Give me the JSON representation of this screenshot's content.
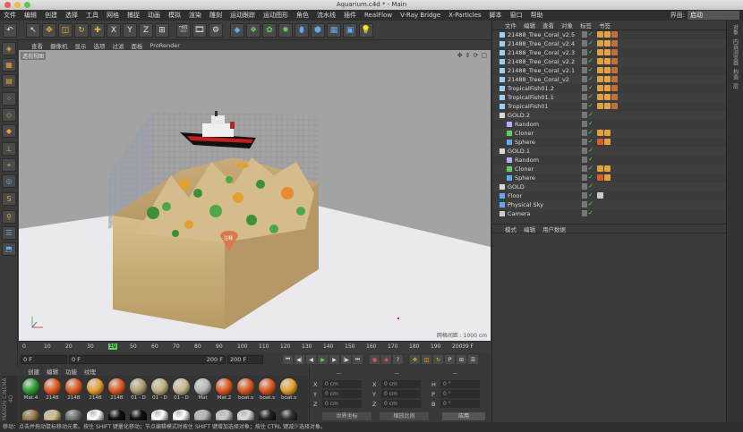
{
  "window": {
    "title": "Aquarium.c4d * - Main"
  },
  "menubar": {
    "items": [
      "文件",
      "编辑",
      "创建",
      "选择",
      "工具",
      "网格",
      "捕捉",
      "动画",
      "模拟",
      "渲染",
      "雕刻",
      "运动跟踪",
      "运动图形",
      "角色",
      "流水线",
      "插件",
      "RealFlow",
      "V-Ray Bridge",
      "X-Particles",
      "脚本",
      "窗口",
      "帮助"
    ],
    "layout_label": "界面:",
    "layout_value": "启动"
  },
  "toolbar": {
    "axis_x": "X",
    "axis_y": "Y",
    "axis_z": "Z"
  },
  "viewport": {
    "menu": [
      "查看",
      "摄像机",
      "显示",
      "选项",
      "过滤",
      "面板",
      "ProRender"
    ],
    "label": "透视视图",
    "grid_spacing": "网格间距 : 1000 cm",
    "note": "注释"
  },
  "timeline": {
    "ticks": [
      "0",
      "10",
      "20",
      "30",
      "39",
      "50",
      "60",
      "70",
      "80",
      "90",
      "100",
      "110",
      "120",
      "130",
      "140",
      "150",
      "160",
      "170",
      "180",
      "190",
      "200"
    ],
    "current": "39",
    "frame_end_readout": "39 F"
  },
  "transport": {
    "start_field": "0 F",
    "min_field": "0 F",
    "max_field": "200 F",
    "end_field": "200 F"
  },
  "materials": {
    "menu": [
      "创建",
      "编辑",
      "功能",
      "纹理"
    ],
    "row1": [
      "Mat.4",
      "214B",
      "214B",
      "214B",
      "214B",
      "01 - D",
      "01 - D",
      "01 - D",
      "Mat",
      "Mat.2",
      "boat.s",
      "boat.s",
      "boat.s"
    ],
    "row1_colors": [
      "#2fa032",
      "#e05a20",
      "#e05a20",
      "#e8a030",
      "#e05a20",
      "#b0a070",
      "#c0b080",
      "#c8b890",
      "#b8b8b8",
      "#e05a20",
      "#e05a20",
      "#e05a20",
      "#e8a030"
    ],
    "row2_colors": [
      "#a08050",
      "#d8c090",
      "#777777",
      "#ffffff",
      "#111111",
      "#111111",
      "#ffffff",
      "#ffffff",
      "#b8b8b8",
      "#cccccc",
      "#dddddd",
      "#222222",
      "#333333"
    ],
    "logo": "MAXON CINEMA 4D"
  },
  "coords": {
    "col_position": "--",
    "col_size": "--",
    "col_rotation": "--",
    "rows": [
      {
        "a": "X",
        "av": "0 cm",
        "b": "X",
        "bv": "0 cm",
        "c": "H",
        "cv": "0 °"
      },
      {
        "a": "Y",
        "av": "0 cm",
        "b": "Y",
        "bv": "0 cm",
        "c": "P",
        "cv": "0 °"
      },
      {
        "a": "Z",
        "av": "0 cm",
        "b": "Z",
        "bv": "0 cm",
        "c": "B",
        "cv": "0 °"
      }
    ],
    "world": "世界坐标",
    "scale": "缩放比例",
    "apply": "应用"
  },
  "objects": {
    "menu": [
      "文件",
      "编辑",
      "查看",
      "对象",
      "标签",
      "书签"
    ],
    "rows": [
      {
        "name": "21488_Tree_Coral_v2.5",
        "indent": 0,
        "type": "mesh"
      },
      {
        "name": "21488_Tree_Coral_v2.4",
        "indent": 0,
        "type": "mesh"
      },
      {
        "name": "21488_Tree_Coral_v2.3",
        "indent": 0,
        "type": "mesh"
      },
      {
        "name": "21488_Tree_Coral_v2.2",
        "indent": 0,
        "type": "mesh"
      },
      {
        "name": "21488_Tree_Coral_v2.1",
        "indent": 0,
        "type": "mesh"
      },
      {
        "name": "21488_Tree_Coral_v2",
        "indent": 0,
        "type": "mesh"
      },
      {
        "name": "TropicalFish01.2",
        "indent": 0,
        "type": "mesh"
      },
      {
        "name": "TropicalFish01.1",
        "indent": 0,
        "type": "mesh"
      },
      {
        "name": "TropicalFish01",
        "indent": 0,
        "type": "mesh"
      },
      {
        "name": "GOLD.2",
        "indent": 0,
        "type": "null"
      },
      {
        "name": "Random",
        "indent": 1,
        "type": "effector"
      },
      {
        "name": "Cloner",
        "indent": 1,
        "type": "cloner"
      },
      {
        "name": "Sphere",
        "indent": 1,
        "type": "sphere"
      },
      {
        "name": "GOLD.1",
        "indent": 0,
        "type": "null"
      },
      {
        "name": "Random",
        "indent": 1,
        "type": "effector"
      },
      {
        "name": "Cloner",
        "indent": 1,
        "type": "cloner"
      },
      {
        "name": "Sphere",
        "indent": 1,
        "type": "sphere"
      },
      {
        "name": "GOLD",
        "indent": 0,
        "type": "null"
      },
      {
        "name": "Floor",
        "indent": 0,
        "type": "floor"
      },
      {
        "name": "Physical Sky",
        "indent": 0,
        "type": "sky"
      },
      {
        "name": "Camera",
        "indent": 0,
        "type": "camera"
      }
    ]
  },
  "attributes": {
    "menu": [
      "模式",
      "编辑",
      "用户数据"
    ]
  },
  "status": {
    "text": "移动：点击并拖动鼠标移动元素。按住 SHIFT 键量化移动；节点编辑模式时按住 SHIFT 键增加选择对象；按住 CTRL 键减少选择对象。"
  },
  "sidetabs": [
    "对象",
    "内容浏览器",
    "构造",
    "层"
  ]
}
